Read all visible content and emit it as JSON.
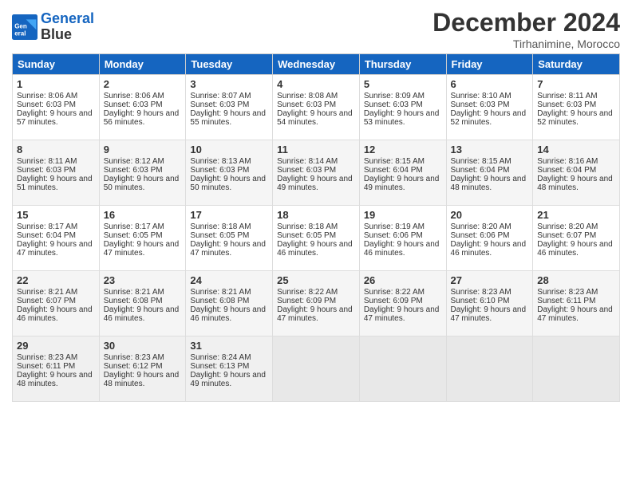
{
  "header": {
    "logo_line1": "General",
    "logo_line2": "Blue",
    "month": "December 2024",
    "location": "Tirhanimine, Morocco"
  },
  "days_of_week": [
    "Sunday",
    "Monday",
    "Tuesday",
    "Wednesday",
    "Thursday",
    "Friday",
    "Saturday"
  ],
  "weeks": [
    [
      {
        "day": "1",
        "sunrise": "Sunrise: 8:06 AM",
        "sunset": "Sunset: 6:03 PM",
        "daylight": "Daylight: 9 hours and 57 minutes."
      },
      {
        "day": "2",
        "sunrise": "Sunrise: 8:06 AM",
        "sunset": "Sunset: 6:03 PM",
        "daylight": "Daylight: 9 hours and 56 minutes."
      },
      {
        "day": "3",
        "sunrise": "Sunrise: 8:07 AM",
        "sunset": "Sunset: 6:03 PM",
        "daylight": "Daylight: 9 hours and 55 minutes."
      },
      {
        "day": "4",
        "sunrise": "Sunrise: 8:08 AM",
        "sunset": "Sunset: 6:03 PM",
        "daylight": "Daylight: 9 hours and 54 minutes."
      },
      {
        "day": "5",
        "sunrise": "Sunrise: 8:09 AM",
        "sunset": "Sunset: 6:03 PM",
        "daylight": "Daylight: 9 hours and 53 minutes."
      },
      {
        "day": "6",
        "sunrise": "Sunrise: 8:10 AM",
        "sunset": "Sunset: 6:03 PM",
        "daylight": "Daylight: 9 hours and 52 minutes."
      },
      {
        "day": "7",
        "sunrise": "Sunrise: 8:11 AM",
        "sunset": "Sunset: 6:03 PM",
        "daylight": "Daylight: 9 hours and 52 minutes."
      }
    ],
    [
      {
        "day": "8",
        "sunrise": "Sunrise: 8:11 AM",
        "sunset": "Sunset: 6:03 PM",
        "daylight": "Daylight: 9 hours and 51 minutes."
      },
      {
        "day": "9",
        "sunrise": "Sunrise: 8:12 AM",
        "sunset": "Sunset: 6:03 PM",
        "daylight": "Daylight: 9 hours and 50 minutes."
      },
      {
        "day": "10",
        "sunrise": "Sunrise: 8:13 AM",
        "sunset": "Sunset: 6:03 PM",
        "daylight": "Daylight: 9 hours and 50 minutes."
      },
      {
        "day": "11",
        "sunrise": "Sunrise: 8:14 AM",
        "sunset": "Sunset: 6:03 PM",
        "daylight": "Daylight: 9 hours and 49 minutes."
      },
      {
        "day": "12",
        "sunrise": "Sunrise: 8:15 AM",
        "sunset": "Sunset: 6:04 PM",
        "daylight": "Daylight: 9 hours and 49 minutes."
      },
      {
        "day": "13",
        "sunrise": "Sunrise: 8:15 AM",
        "sunset": "Sunset: 6:04 PM",
        "daylight": "Daylight: 9 hours and 48 minutes."
      },
      {
        "day": "14",
        "sunrise": "Sunrise: 8:16 AM",
        "sunset": "Sunset: 6:04 PM",
        "daylight": "Daylight: 9 hours and 48 minutes."
      }
    ],
    [
      {
        "day": "15",
        "sunrise": "Sunrise: 8:17 AM",
        "sunset": "Sunset: 6:04 PM",
        "daylight": "Daylight: 9 hours and 47 minutes."
      },
      {
        "day": "16",
        "sunrise": "Sunrise: 8:17 AM",
        "sunset": "Sunset: 6:05 PM",
        "daylight": "Daylight: 9 hours and 47 minutes."
      },
      {
        "day": "17",
        "sunrise": "Sunrise: 8:18 AM",
        "sunset": "Sunset: 6:05 PM",
        "daylight": "Daylight: 9 hours and 47 minutes."
      },
      {
        "day": "18",
        "sunrise": "Sunrise: 8:18 AM",
        "sunset": "Sunset: 6:05 PM",
        "daylight": "Daylight: 9 hours and 46 minutes."
      },
      {
        "day": "19",
        "sunrise": "Sunrise: 8:19 AM",
        "sunset": "Sunset: 6:06 PM",
        "daylight": "Daylight: 9 hours and 46 minutes."
      },
      {
        "day": "20",
        "sunrise": "Sunrise: 8:20 AM",
        "sunset": "Sunset: 6:06 PM",
        "daylight": "Daylight: 9 hours and 46 minutes."
      },
      {
        "day": "21",
        "sunrise": "Sunrise: 8:20 AM",
        "sunset": "Sunset: 6:07 PM",
        "daylight": "Daylight: 9 hours and 46 minutes."
      }
    ],
    [
      {
        "day": "22",
        "sunrise": "Sunrise: 8:21 AM",
        "sunset": "Sunset: 6:07 PM",
        "daylight": "Daylight: 9 hours and 46 minutes."
      },
      {
        "day": "23",
        "sunrise": "Sunrise: 8:21 AM",
        "sunset": "Sunset: 6:08 PM",
        "daylight": "Daylight: 9 hours and 46 minutes."
      },
      {
        "day": "24",
        "sunrise": "Sunrise: 8:21 AM",
        "sunset": "Sunset: 6:08 PM",
        "daylight": "Daylight: 9 hours and 46 minutes."
      },
      {
        "day": "25",
        "sunrise": "Sunrise: 8:22 AM",
        "sunset": "Sunset: 6:09 PM",
        "daylight": "Daylight: 9 hours and 47 minutes."
      },
      {
        "day": "26",
        "sunrise": "Sunrise: 8:22 AM",
        "sunset": "Sunset: 6:09 PM",
        "daylight": "Daylight: 9 hours and 47 minutes."
      },
      {
        "day": "27",
        "sunrise": "Sunrise: 8:23 AM",
        "sunset": "Sunset: 6:10 PM",
        "daylight": "Daylight: 9 hours and 47 minutes."
      },
      {
        "day": "28",
        "sunrise": "Sunrise: 8:23 AM",
        "sunset": "Sunset: 6:11 PM",
        "daylight": "Daylight: 9 hours and 47 minutes."
      }
    ],
    [
      {
        "day": "29",
        "sunrise": "Sunrise: 8:23 AM",
        "sunset": "Sunset: 6:11 PM",
        "daylight": "Daylight: 9 hours and 48 minutes."
      },
      {
        "day": "30",
        "sunrise": "Sunrise: 8:23 AM",
        "sunset": "Sunset: 6:12 PM",
        "daylight": "Daylight: 9 hours and 48 minutes."
      },
      {
        "day": "31",
        "sunrise": "Sunrise: 8:24 AM",
        "sunset": "Sunset: 6:13 PM",
        "daylight": "Daylight: 9 hours and 49 minutes."
      },
      null,
      null,
      null,
      null
    ]
  ]
}
